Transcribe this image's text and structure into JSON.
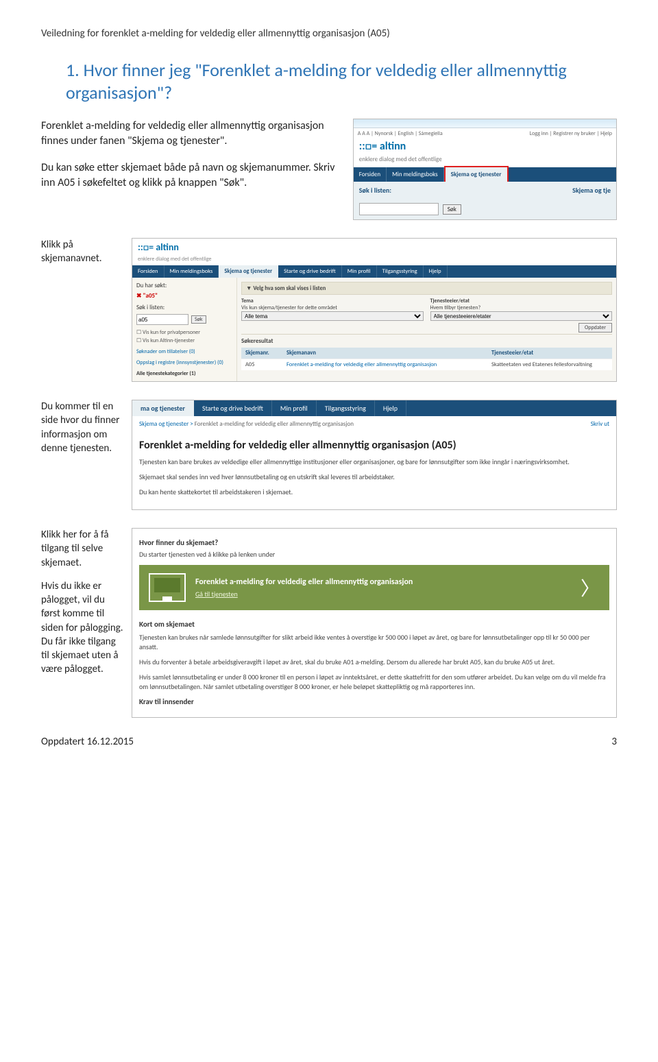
{
  "doc_header": "Veiledning for forenklet a-melding for veldedig eller allmennyttig organisasjon (A05)",
  "section_title": "1.   Hvor finner jeg \"Forenklet a-melding for veldedig eller allmennyttig organisasjon\"?",
  "intro": {
    "p1": "Forenklet a-melding for veldedig eller allmennyttig organisasjon finnes under fanen \"Skjema og tjenester\".",
    "p2": "Du kan søke etter skjemaet både på navn og skjemanummer. Skriv inn A05 i søkefeltet og klikk på knappen \"Søk\"."
  },
  "altinn": {
    "toprow_left": "A A A | Nynorsk | English | Sámegiella",
    "toprow_right": "Logg inn | Registrer ny bruker | Hjelp",
    "brand_prefix": "::□=",
    "brand_name": "altinn",
    "slogan": "enklere dialog med det offentlige",
    "tabs": [
      "Forsiden",
      "Min meldingsboks",
      "Skjema og tjenester"
    ],
    "search_label": "Søk i listen:",
    "search_btn": "Søk",
    "right_tab_cut": "Skjema og tje"
  },
  "line2": "Klikk på skjemanavnet.",
  "wide": {
    "tabs": [
      "Forsiden",
      "Min meldingsboks",
      "Skjema og tjenester",
      "Starte og drive bedrift",
      "Min profil",
      "Tilgangsstyring",
      "Hjelp"
    ],
    "left": {
      "hdr": "Du har søkt:",
      "query": "✖ \"a05\"",
      "search_label": "Søk i listen:",
      "search_value": "a05",
      "search_btn": "Søk",
      "chk1": "Vis kun for privatpersoner",
      "chk2": "Vis kun Altinn-tjenester",
      "lnk1": "Søknader om tillatelser (0)",
      "lnk2": "Oppslag i registre (innsynstjenester) (0)",
      "lnk3": "Alle tjenestekategorier (1)"
    },
    "filterbar": "▼ Velg hva som skal vises i listen",
    "filters": {
      "tema_lbl": "Tema",
      "tema_sub": "Vis kun skjema/tjenester for dette området",
      "tema_val": "Alle tema",
      "etat_lbl": "Tjenesteeier/etat",
      "etat_sub": "Hvem tilbyr tjenesten?",
      "etat_val": "Alle tjenesteeiere/etater"
    },
    "oppdater": "Oppdater",
    "reshdr": "Søkeresultat",
    "cols": {
      "c1": "Skjemanr.",
      "c2": "Skjemanavn",
      "c3": "Tjenesteeier/etat"
    },
    "row": {
      "c1": "A05",
      "c2": "Forenklet a-melding for veldedig eller allmennyttig organisasjon",
      "c3": "Skatteetaten ved Etatenes fellesforvaltning"
    }
  },
  "note3": "Du kommer til en side hvor du finner informasjon om denne tjenesten.",
  "note4a": "Klikk her for å få tilgang til selve skjemaet.",
  "note4b": "Hvis du ikke er pålogget, vil du først komme til siden for pålogging. Du får ikke tilgang til skjemaet uten å være pålogget.",
  "info": {
    "tabs": [
      "ma og tjenester",
      "Starte og drive bedrift",
      "Min profil",
      "Tilgangsstyring",
      "Hjelp"
    ],
    "crumb_a": "Skjema og tjenester",
    "crumb_sep": " > ",
    "crumb_b": "Forenklet a-melding for veldedig eller allmennyttig organisasjon",
    "print": "Skriv ut",
    "title": "Forenklet a-melding for veldedig eller allmennyttig organisasjon (A05)",
    "p1": "Tjenesten kan bare brukes av veldedige eller allmennyttige institusjoner eller organisasjoner, og bare for lønnsutgifter som ikke inngår i næringsvirksomhet.",
    "p2": "Skjemaet skal sendes inn ved hver lønnsutbetaling og en utskrift skal leveres til arbeidstaker.",
    "p3": "Du kan hente skattekortet til arbeidstakeren i skjemaet.",
    "q": "Hvor finner du skjemaet?",
    "q_sub": "Du starter tjenesten ved å klikke på lenken under",
    "launch_title": "Forenklet a-melding for veldedig eller allmennyttig organisasjon",
    "launch_link": "Gå til tjenesten",
    "kort": "Kort om skjemaet",
    "k1": "Tjenesten kan brukes når samlede lønnsutgifter for slikt arbeid ikke ventes å overstige kr 500 000 i løpet av året, og bare for lønnsutbetalinger opp til kr 50 000 per ansatt.",
    "k2": "Hvis du forventer å betale arbeidsgiveravgift i løpet av året, skal du bruke A01 a-melding. Dersom du allerede har brukt A05, kan du bruke A05 ut året.",
    "k3": "Hvis samlet lønnsutbetaling er under 8 000 kroner til en person i løpet av inntektsåret, er dette skattefritt for den som utfører arbeidet. Du kan velge om du vil melde fra om lønnsutbetalingen. Når samlet utbetaling overstiger 8 000 kroner, er hele beløpet skattepliktig og må rapporteres inn.",
    "k4": "Krav til innsender"
  },
  "footer": {
    "left": "Oppdatert 16.12.2015",
    "right": "3"
  }
}
